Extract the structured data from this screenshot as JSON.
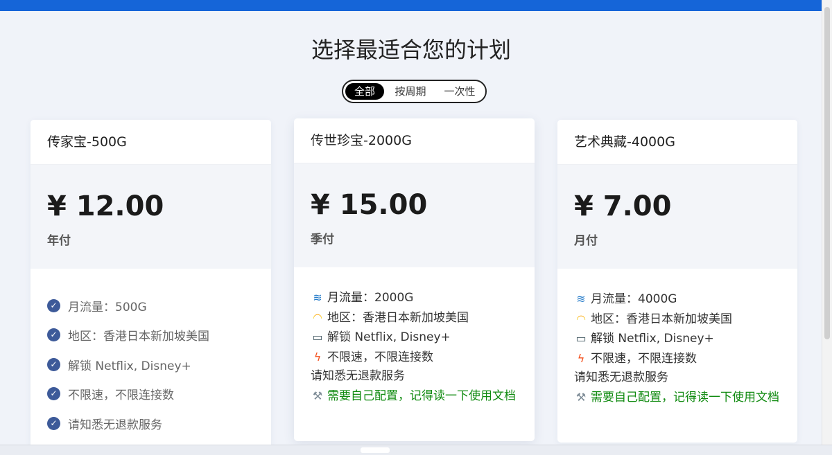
{
  "page": {
    "title": "选择最适合您的计划"
  },
  "toggle": {
    "options": [
      "全部",
      "按周期",
      "一次性"
    ],
    "active": "全部"
  },
  "plans": [
    {
      "name": "传家宝-500G",
      "price": "¥ 12.00",
      "period": "年付",
      "features": [
        "月流量：500G",
        "地区：香港日本新加坡美国",
        "解锁 Netflix, Disney+",
        "不限速，不限连接数",
        "请知悉无退款服务"
      ]
    },
    {
      "name": "传世珍宝-2000G",
      "price": "¥ 15.00",
      "period": "季付",
      "features": [
        "月流量：2000G",
        "地区：香港日本新加坡美国",
        "解锁 Netflix, Disney+",
        "不限速，不限连接数",
        "请知悉无退款服务"
      ],
      "note": "需要自己配置，记得读一下使用文档"
    },
    {
      "name": "艺术典藏-4000G",
      "price": "¥ 7.00",
      "period": "月付",
      "features": [
        "月流量：4000G",
        "地区：香港日本新加坡美国",
        "解锁 Netflix, Disney+",
        "不限速，不限连接数",
        "请知悉无退款服务"
      ],
      "note": "需要自己配置，记得读一下使用文档"
    }
  ],
  "icons": {
    "check": "check-circle-icon",
    "traffic": "wave-icon",
    "region": "rainbow-icon",
    "unlock": "tv-icon",
    "speed": "lightning-icon",
    "config": "wrench-icon"
  },
  "colors": {
    "topbar": "#1565d8",
    "background": "#f0f3f9",
    "check": "#3d5a99",
    "note": "#0f8a0f",
    "toggle_active": "#000000"
  }
}
